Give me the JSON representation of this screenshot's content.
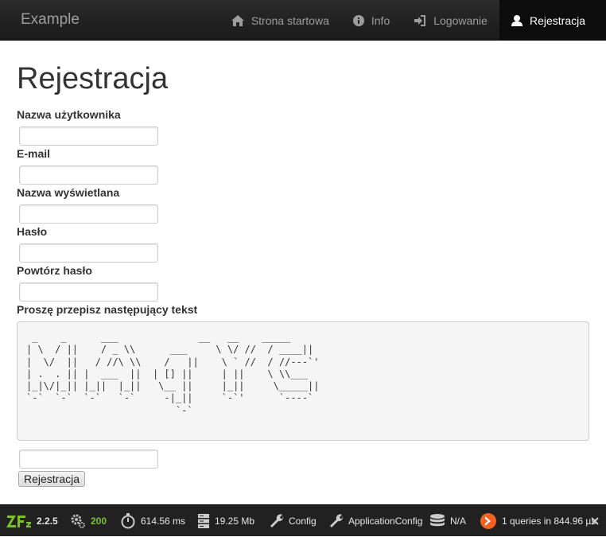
{
  "navbar": {
    "brand": "Example",
    "items": [
      {
        "label": "Strona startowa",
        "icon": "home-icon",
        "active": false
      },
      {
        "label": "Info",
        "icon": "info-icon",
        "active": false
      },
      {
        "label": "Logowanie",
        "icon": "login-icon",
        "active": false
      },
      {
        "label": "Rejestracja",
        "icon": "user-icon",
        "active": true
      }
    ]
  },
  "page": {
    "title": "Rejestracja"
  },
  "form": {
    "fields": [
      {
        "label": "Nazwa użytkownika",
        "value": ""
      },
      {
        "label": "E-mail",
        "value": ""
      },
      {
        "label": "Nazwa wyświetlana",
        "value": ""
      },
      {
        "label": "Hasło",
        "value": ""
      },
      {
        "label": "Powtórz hasło",
        "value": ""
      }
    ],
    "captcha_label": "Proszę przepisz następujący tekst",
    "captcha_art": " _    _      ___              __   __    _____\n| \\  / ||    / _ \\\\      ___     \\ \\/ //  / ____||\n|  \\/  ||   / //\\ \\\\    /   ||    \\ ` //  / //---`'\n| .  . || |  ___  ||  | [] ||     | ||    \\ \\\\___\n|_|\\/|_|| |_||  |_||   \\__ ||     |_||     \\_____||\n`-`  `-`  `-`   `-`     -|_||     `-`'      `----`\n                          `-`",
    "captcha_value": "",
    "submit_label": "Rejestracja"
  },
  "toolbar": {
    "version": "2.2.5",
    "status_code": "200",
    "time": "614.56 ms",
    "memory": "19.25 Mb",
    "config": "Config",
    "app_config": "ApplicationConfig",
    "db": "N/A",
    "queries": "1 queries in 844.96 µs",
    "colors": {
      "accent_green": "#7fbf2a",
      "zf_orange": "#f26322"
    }
  }
}
